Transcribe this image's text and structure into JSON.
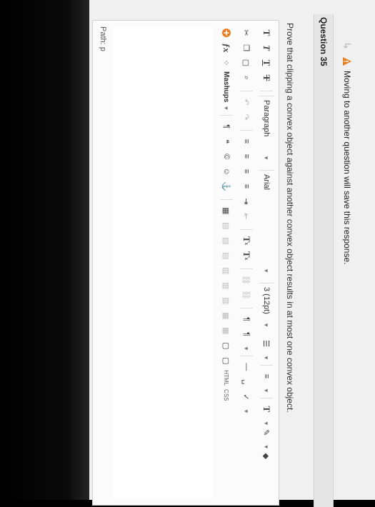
{
  "warning": {
    "text": "Moving to another question will save this response."
  },
  "question": {
    "title": "Question 35",
    "prompt": "Prove that clipping a convex object against another convex object results in at most one convex object."
  },
  "toolbar": {
    "row1": {
      "bold": "T",
      "italic": "T",
      "underline": "T",
      "strike": "T",
      "paragraph": "Paragraph",
      "font": "Arial",
      "size": "3 (12pt)",
      "text_color": "T"
    },
    "row2": {
      "superscript": "T",
      "subscript": "T"
    },
    "row3": {
      "mashups": "Mashups",
      "html": "HTML",
      "css": "CSS"
    }
  },
  "path": {
    "label": "Path: p"
  },
  "colors": {
    "warning_orange": "#e67e22",
    "text": "#333333",
    "header_bg": "#e6e6e6"
  }
}
